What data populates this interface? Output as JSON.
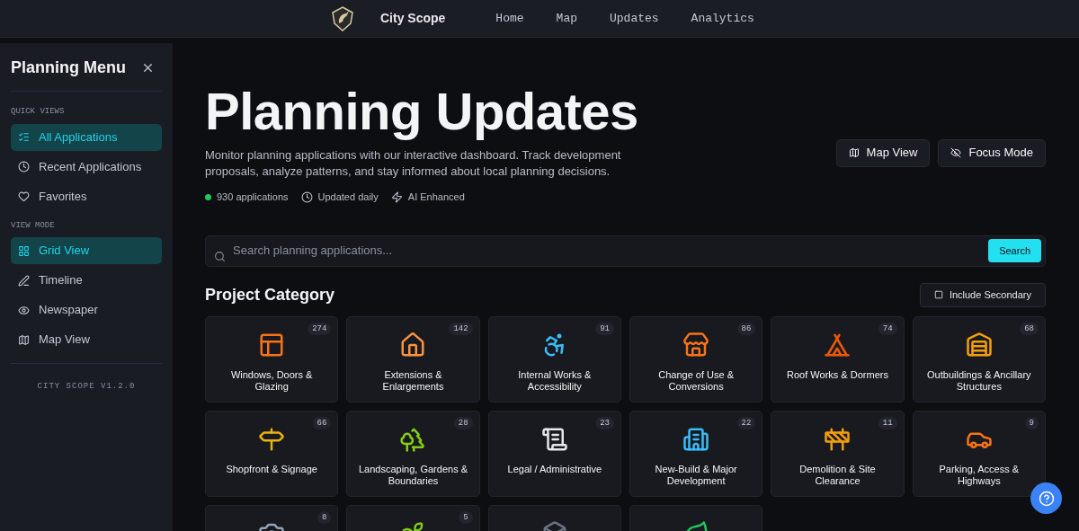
{
  "topbar": {
    "brand": "City Scope",
    "links": [
      {
        "label": "Home",
        "selected": false
      },
      {
        "label": "Map",
        "selected": false
      },
      {
        "label": "Updates",
        "selected": false
      },
      {
        "label": "Analytics",
        "selected": false
      }
    ]
  },
  "sidebar": {
    "title": "Planning Menu",
    "sections": [
      {
        "heading": "QUICK VIEWS",
        "items": [
          {
            "label": "All Applications",
            "selected": true
          },
          {
            "label": "Recent Applications",
            "selected": false
          },
          {
            "label": "Favorites",
            "selected": false
          }
        ]
      },
      {
        "heading": "VIEW MODE",
        "items": [
          {
            "label": "Grid View",
            "selected": true
          },
          {
            "label": "Timeline",
            "selected": false
          },
          {
            "label": "Newspaper",
            "selected": false
          },
          {
            "label": "Map View",
            "selected": false
          }
        ]
      }
    ],
    "version": "CITY SCOPE V1.2.0"
  },
  "hero": {
    "title": "Planning Updates",
    "description": "Monitor planning applications with our interactive dashboard. Track development proposals, analyze patterns, and stay informed about local planning decisions.",
    "stats": [
      {
        "kind": "dot",
        "label": "930 applications",
        "color": "#22c55e"
      },
      {
        "kind": "clock",
        "label": "Updated daily"
      },
      {
        "kind": "bolt",
        "label": "AI Enhanced"
      }
    ],
    "buttons": [
      "Map View",
      "Focus Mode"
    ]
  },
  "search": {
    "placeholder": "Search planning applications...",
    "button": "Search"
  },
  "categories": {
    "title": "Project Category",
    "toggle": {
      "label": "Include Secondary",
      "checked": false
    },
    "items": [
      {
        "kind": "category",
        "label": "Windows, Doors & Glazing",
        "count": "274"
      },
      {
        "kind": "category",
        "label": "Extensions & Enlargements",
        "count": "142"
      },
      {
        "kind": "category",
        "label": "Internal Works & Accessibility",
        "count": "91"
      },
      {
        "kind": "category",
        "label": "Change of Use & Conversions",
        "count": "86"
      },
      {
        "kind": "category",
        "label": "Roof Works & Dormers",
        "count": "74"
      },
      {
        "kind": "category",
        "label": "Outbuildings & Ancillary Structures",
        "count": "68"
      },
      {
        "kind": "category",
        "label": "Shopfront & Signage",
        "count": "66"
      },
      {
        "kind": "category",
        "label": "Landscaping, Gardens & Boundaries",
        "count": "28"
      },
      {
        "kind": "category",
        "label": "Legal / Administrative",
        "count": "23"
      },
      {
        "kind": "category",
        "label": "New-Build & Major Development",
        "count": "22"
      },
      {
        "kind": "category",
        "label": "Demolition & Site Clearance",
        "count": "11"
      },
      {
        "kind": "category",
        "label": "Parking, Access & Highways",
        "count": "9"
      },
      {
        "kind": "category",
        "count": "8"
      },
      {
        "kind": "category",
        "count": "5"
      },
      {
        "kind": "category"
      },
      {
        "kind": "category"
      }
    ]
  }
}
